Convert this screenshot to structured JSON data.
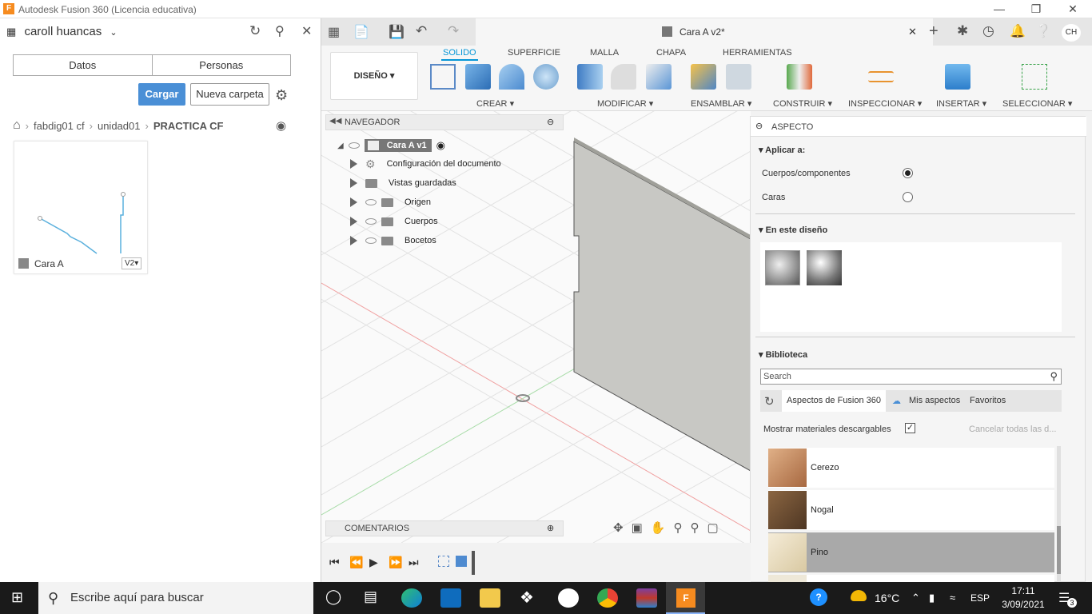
{
  "window": {
    "title": "Autodesk Fusion 360 (Licencia educativa)",
    "logo_letter": "F"
  },
  "left": {
    "user": "caroll huancas",
    "tabs": [
      "Datos",
      "Personas"
    ],
    "upload_label": "Cargar",
    "new_folder_label": "Nueva carpeta",
    "breadcrumb": [
      "fabdig01 cf",
      "unidad01",
      "PRACTICA CF"
    ],
    "file": {
      "name": "Cara A",
      "version": "V2"
    }
  },
  "doc": {
    "tab_title": "Cara A v2*",
    "user_initials": "CH"
  },
  "toolbar": {
    "workspace": "DISEÑO",
    "tabs": [
      "SOLIDO",
      "SUPERFICIE",
      "MALLA",
      "CHAPA",
      "HERRAMIENTAS"
    ],
    "groups": [
      "CREAR",
      "MODIFICAR",
      "ENSAMBLAR",
      "CONSTRUIR",
      "INSPECCIONAR",
      "INSERTAR",
      "SELECCIONAR"
    ]
  },
  "navigator": {
    "title": "NAVEGADOR",
    "root": "Cara A v1",
    "items": [
      "Configuración del documento",
      "Vistas guardadas",
      "Origen",
      "Cuerpos",
      "Bocetos"
    ]
  },
  "comments": {
    "title": "COMENTARIOS"
  },
  "aspect": {
    "title": "ASPECTO",
    "apply_to": "Aplicar a:",
    "options": [
      "Cuerpos/componentes",
      "Caras"
    ],
    "in_design": "En este diseño",
    "library": "Biblioteca",
    "search_placeholder": "Search",
    "lib_tabs": [
      "Aspectos de Fusion 360",
      "Mis aspectos",
      "Favoritos"
    ],
    "show_downloadable": "Mostrar materiales descargables",
    "cancel_all": "Cancelar todas las d...",
    "materials": [
      "Cerezo",
      "Nogal",
      "Pino"
    ]
  },
  "taskbar": {
    "search": "Escribe aquí para buscar",
    "temp": "16°C",
    "lang": "ESP",
    "time": "17:11",
    "date": "3/09/2021",
    "notifications": "3"
  }
}
